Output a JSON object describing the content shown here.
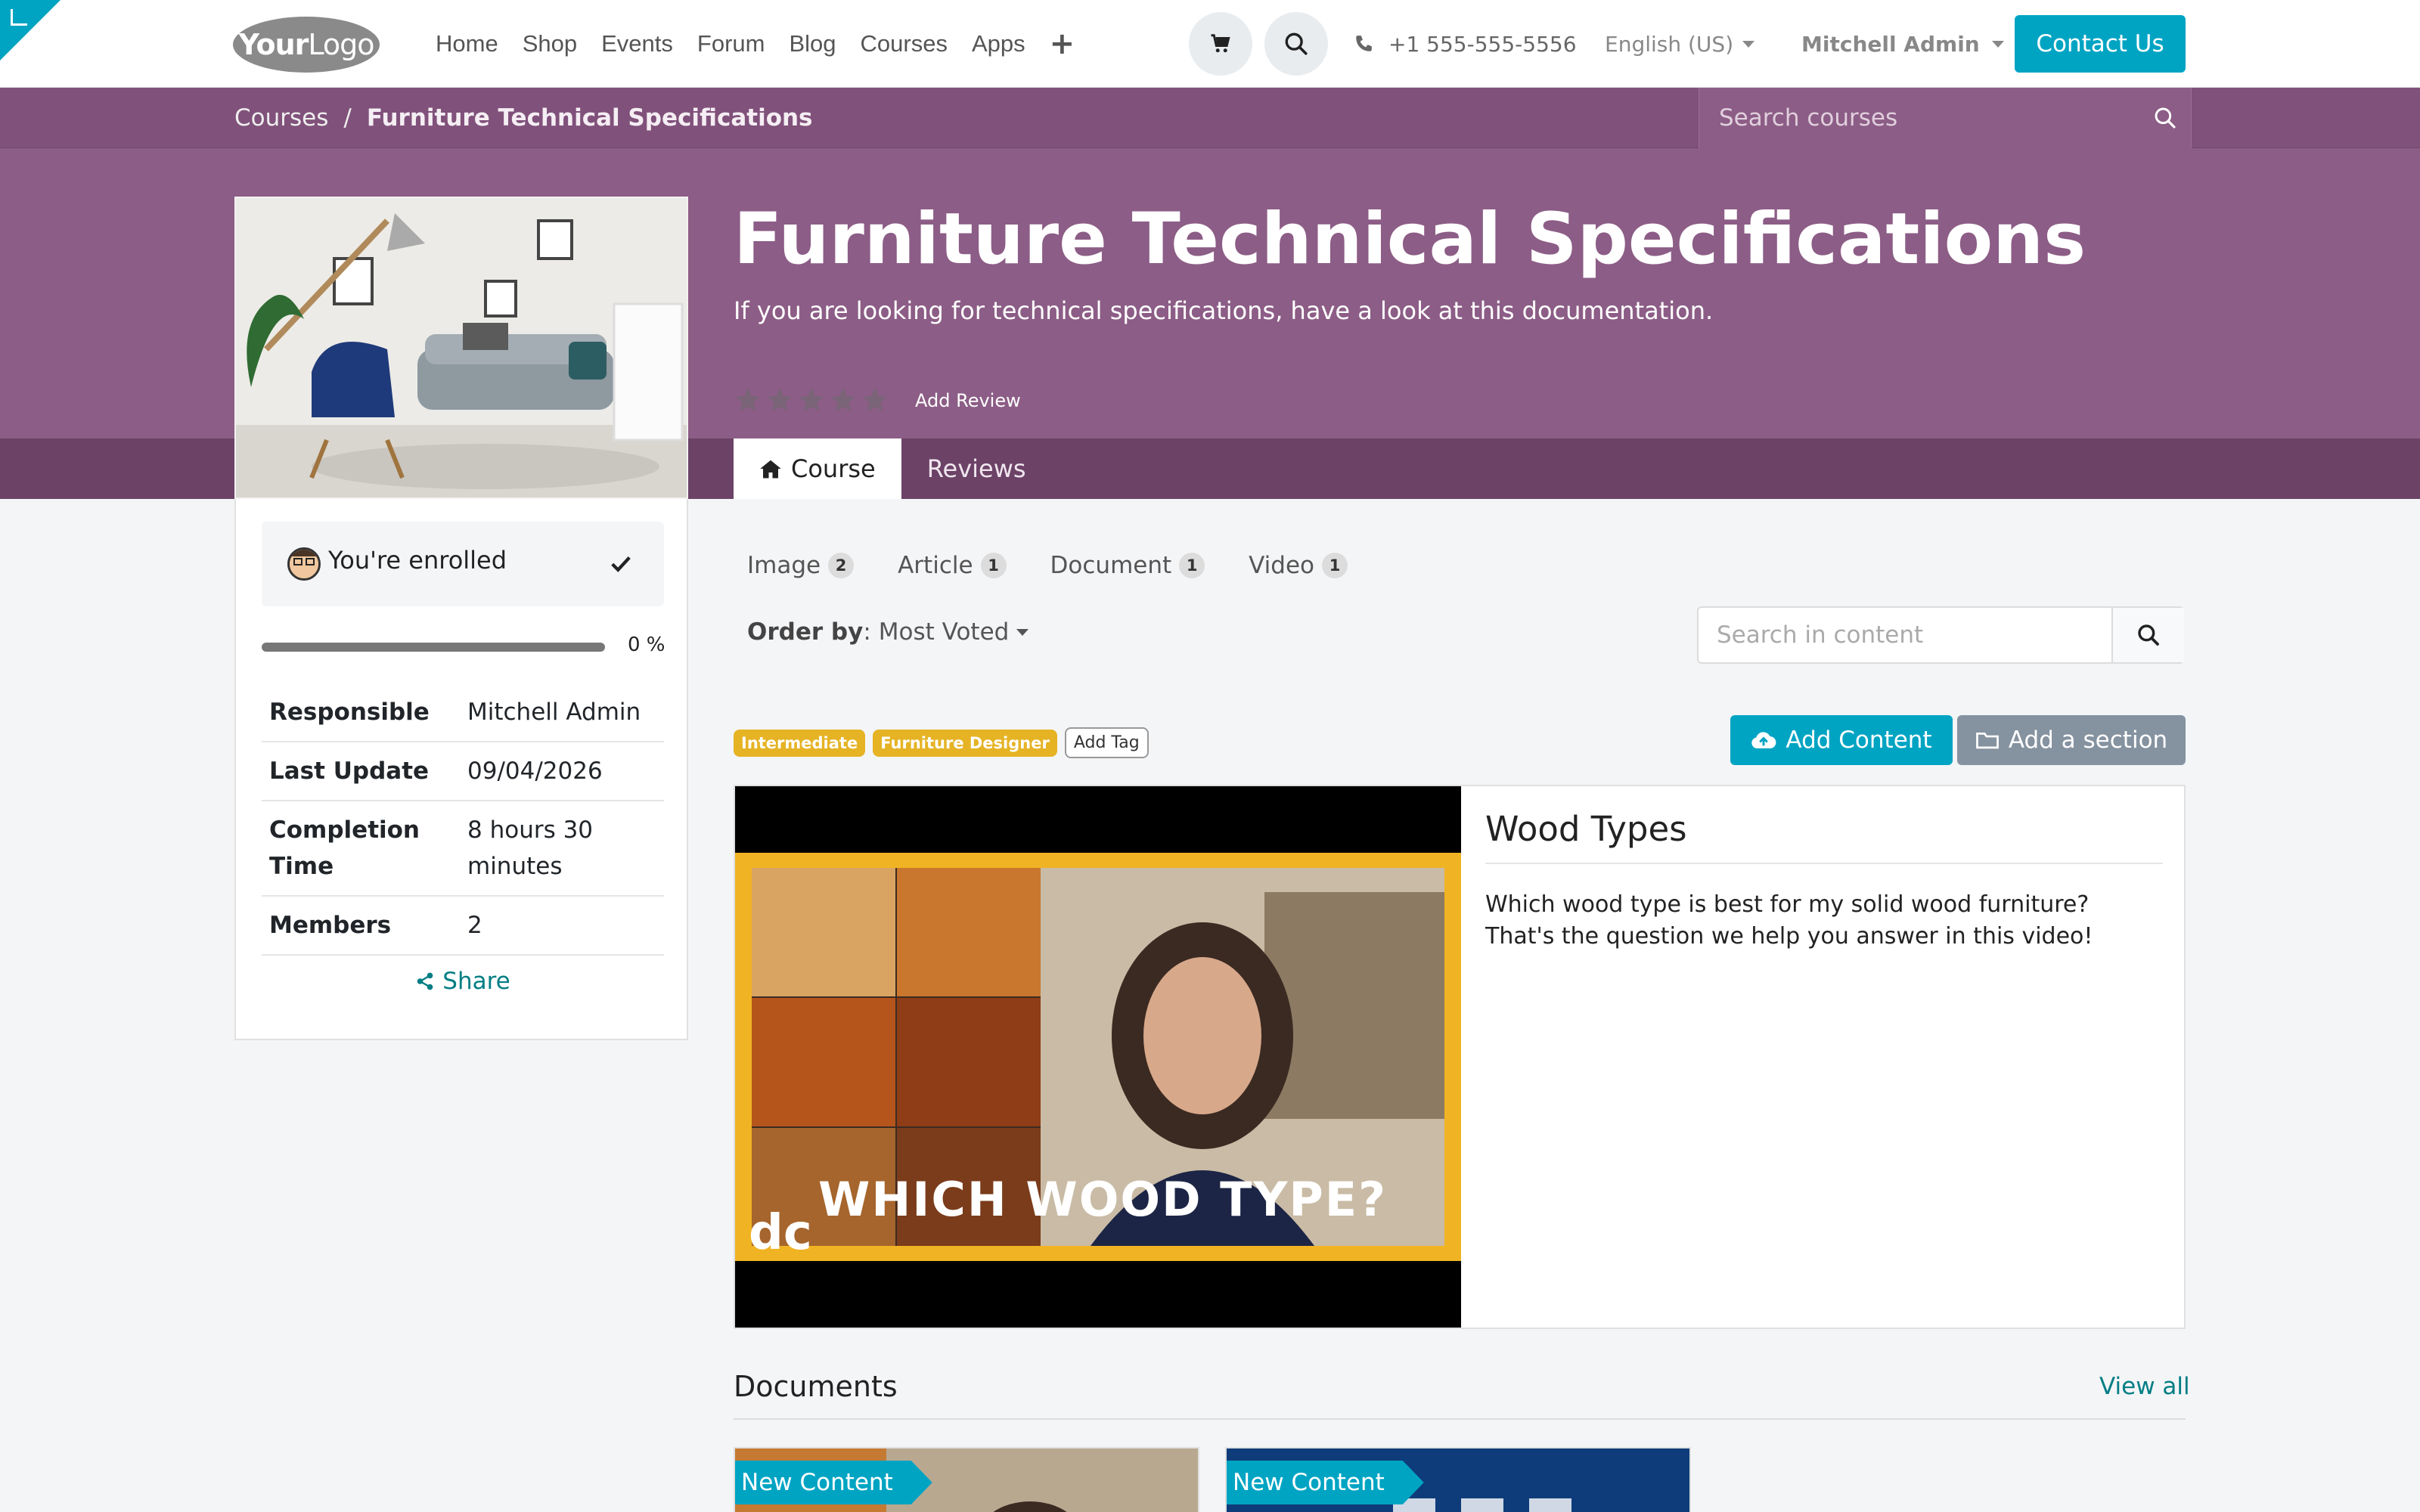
{
  "nav": {
    "logo_bold": "Your",
    "logo_light": "Logo",
    "menu": [
      "Home",
      "Shop",
      "Events",
      "Forum",
      "Blog",
      "Courses",
      "Apps"
    ],
    "phone": "+1 555-555-5556",
    "language": "English (US)",
    "user": "Mitchell Admin",
    "contact": "Contact Us"
  },
  "breadcrumb": {
    "root": "Courses",
    "separator": "/",
    "current": "Furniture Technical Specifications"
  },
  "course_search": {
    "placeholder": "Search courses"
  },
  "course": {
    "title": "Furniture Technical Specifications",
    "description": "If you are looking for technical specifications, have a look at this documentation.",
    "rating_stars": 0,
    "rating_max": 5,
    "add_review": "Add Review"
  },
  "tabs": [
    {
      "label": "Course",
      "icon": "home-icon",
      "active": true
    },
    {
      "label": "Reviews",
      "active": false
    }
  ],
  "sidebar": {
    "enrolled": "You're enrolled",
    "progress_pct": "0 %",
    "progress_value": 0,
    "info": [
      {
        "key": "Responsible",
        "value": "Mitchell Admin"
      },
      {
        "key": "Last Update",
        "value": "09/04/2026"
      },
      {
        "key": "Completion Time",
        "value": "8 hours 30 minutes"
      },
      {
        "key": "Members",
        "value": "2"
      }
    ],
    "share": "Share"
  },
  "filters": [
    {
      "label": "Image",
      "count": "2"
    },
    {
      "label": "Article",
      "count": "1"
    },
    {
      "label": "Document",
      "count": "1"
    },
    {
      "label": "Video",
      "count": "1"
    }
  ],
  "order": {
    "label": "Order by",
    "value": "Most Voted"
  },
  "content_search": {
    "placeholder": "Search in content"
  },
  "tags": [
    "Intermediate",
    "Furniture Designer"
  ],
  "add_tag": "Add Tag",
  "actions": {
    "add_content": "Add Content",
    "add_section": "Add a section"
  },
  "featured": {
    "title": "Wood Types",
    "description": "Which wood type is best for my solid wood furniture? That's the question we help you answer in this video!",
    "thumb_caption": "WHICH WOOD TYPE?",
    "thumb_brand": "dc"
  },
  "documents": {
    "title": "Documents",
    "view_all": "View all",
    "cards": [
      {
        "ribbon": "New Content"
      },
      {
        "ribbon": "New Content"
      }
    ]
  },
  "colors": {
    "primary": "#00a4c3",
    "hero": "#8c5d86",
    "hero_dark": "#6c4267",
    "tag": "#e5b324",
    "link": "#017e84"
  }
}
